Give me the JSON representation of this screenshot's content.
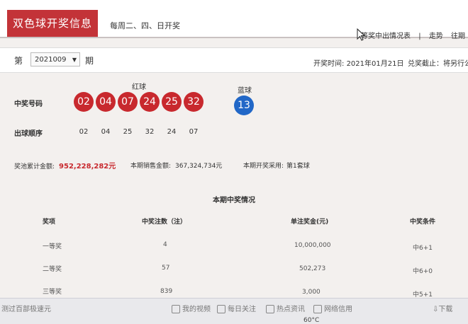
{
  "header": {
    "title": "双色球开奖信息",
    "schedule": "每周二、四、日开奖",
    "links": [
      "等奖中出情况表",
      "|",
      "走势",
      "往期"
    ]
  },
  "draw": {
    "label_di": "第",
    "issue": "2021009",
    "label_qi": "期",
    "date_label": "开奖时间:",
    "date_value": "2021年01月21日",
    "redeem_label": "兑奖截止：将另行公"
  },
  "numbers": {
    "red_label": "红球",
    "blue_label": "蓝球",
    "winning_label": "中奖号码",
    "order_label": "出球顺序",
    "red_balls": [
      "02",
      "04",
      "07",
      "24",
      "25",
      "32"
    ],
    "blue_ball": "13",
    "order": [
      "02",
      "04",
      "25",
      "32",
      "24",
      "07"
    ]
  },
  "stats": {
    "jackpot_label": "奖池累计金额:",
    "jackpot_value": "952,228,282元",
    "sales_label": "本期销售金额:",
    "sales_value": "367,324,734元",
    "method_label": "本期开奖采用:",
    "method_value": "第1套球"
  },
  "prizes": {
    "title": "本期中奖情况",
    "headers": [
      "奖项",
      "中奖注数（注）",
      "单注奖金(元)",
      "中奖条件"
    ],
    "rows": [
      {
        "level": "一等奖",
        "count": "4",
        "amount": "10,000,000",
        "condition": "中6+1"
      },
      {
        "level": "二等奖",
        "count": "57",
        "amount": "502,273",
        "condition": "中6+0"
      },
      {
        "level": "三等奖",
        "count": "839",
        "amount": "3,000",
        "condition": "中5+1"
      }
    ]
  },
  "taskbar": {
    "left_text": "测过百部极速元",
    "items": [
      "我的视频",
      "每日关注",
      "热点资讯",
      "网络信用"
    ],
    "download": "下载",
    "temperature": "60°C"
  },
  "colors": {
    "brand_red": "#c33338",
    "red_ball": "#c8292e",
    "blue_ball": "#2167c7"
  }
}
